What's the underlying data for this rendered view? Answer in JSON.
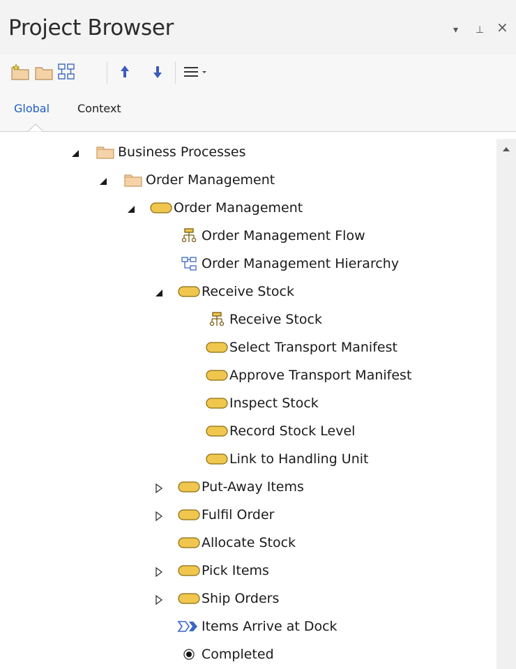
{
  "panel": {
    "title": "Project Browser"
  },
  "window_controls": [
    {
      "name": "dropdown-icon",
      "glyph": "▾"
    },
    {
      "name": "pin-icon",
      "glyph": "⊥"
    },
    {
      "name": "close-icon",
      "glyph": "×"
    }
  ],
  "toolbar": {
    "buttons": [
      "new-model-icon",
      "new-package-icon",
      "new-diagram-icon",
      "move-up-icon",
      "move-down-icon",
      "menu-icon"
    ]
  },
  "tabs": [
    {
      "label": "Global",
      "active": true
    },
    {
      "label": "Context",
      "active": false
    }
  ],
  "tree": {
    "items": [
      {
        "label": "Business Processes",
        "level": 0,
        "icon": "package-icon",
        "toggle": "expanded"
      },
      {
        "label": "Order Management",
        "level": 1,
        "icon": "package-icon",
        "toggle": "expanded"
      },
      {
        "label": "Order Management",
        "level": 2,
        "icon": "activity-icon",
        "toggle": "expanded"
      },
      {
        "label": "Order Management Flow",
        "level": 3,
        "icon": "bpmn-diagram-icon",
        "toggle": "none"
      },
      {
        "label": "Order Management Hierarchy",
        "level": 3,
        "icon": "hierarchy-diagram-icon",
        "toggle": "none"
      },
      {
        "label": "Receive Stock",
        "level": 3,
        "icon": "activity-icon",
        "toggle": "expanded"
      },
      {
        "label": "Receive Stock",
        "level": 4,
        "icon": "bpmn-diagram-icon",
        "toggle": "none"
      },
      {
        "label": "Select Transport Manifest",
        "level": 4,
        "icon": "activity-icon",
        "toggle": "none"
      },
      {
        "label": "Approve Transport Manifest",
        "level": 4,
        "icon": "activity-icon",
        "toggle": "none"
      },
      {
        "label": "Inspect Stock",
        "level": 4,
        "icon": "activity-icon",
        "toggle": "none"
      },
      {
        "label": "Record Stock Level",
        "level": 4,
        "icon": "activity-icon",
        "toggle": "none"
      },
      {
        "label": "Link to Handling Unit",
        "level": 4,
        "icon": "activity-icon",
        "toggle": "none"
      },
      {
        "label": "Put-Away Items",
        "level": 3,
        "icon": "activity-icon",
        "toggle": "collapsed"
      },
      {
        "label": "Fulfil Order",
        "level": 3,
        "icon": "activity-icon",
        "toggle": "collapsed"
      },
      {
        "label": "Allocate Stock",
        "level": 3,
        "icon": "activity-icon",
        "toggle": "none"
      },
      {
        "label": "Pick Items",
        "level": 3,
        "icon": "activity-icon",
        "toggle": "collapsed"
      },
      {
        "label": "Ship Orders",
        "level": 3,
        "icon": "activity-icon",
        "toggle": "collapsed"
      },
      {
        "label": "Items Arrive at Dock",
        "level": 3,
        "icon": "start-event-icon",
        "toggle": "none"
      },
      {
        "label": "Completed",
        "level": 3,
        "icon": "end-event-icon",
        "toggle": "none"
      }
    ]
  },
  "colors": {
    "activity_fill": "#f0c64e",
    "activity_stroke": "#8a6d10",
    "folder_fill": "#f6d2a8",
    "folder_stroke": "#c79a62",
    "active_tab": "#1e5ec8",
    "arrow_blue": "#3b5bbd"
  }
}
